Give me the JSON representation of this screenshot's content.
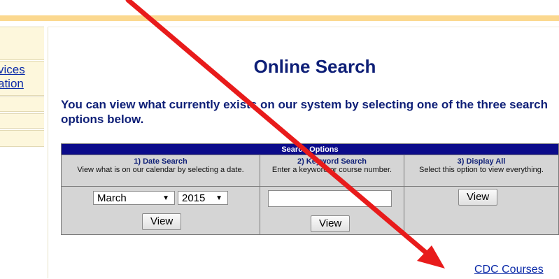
{
  "sidebar": {
    "links": [
      "vices",
      "ation"
    ]
  },
  "main": {
    "title": "Online Search",
    "intro": "You can view what currently exists on our system by selecting one of the three search options below."
  },
  "search_table": {
    "header": "Search Options",
    "options": [
      {
        "title": "1) Date Search",
        "desc": "View what is on our calendar by selecting a date."
      },
      {
        "title": "2) Keyword Search",
        "desc": "Enter a keyword or course number."
      },
      {
        "title": "3) Display All",
        "desc": "Select this option to view everything."
      }
    ],
    "month_value": "March",
    "year_value": "2015",
    "keyword_value": "",
    "view_label": "View"
  },
  "footer": {
    "link": "CDC Courses"
  },
  "colors": {
    "header_bg": "#0b0b8a",
    "title_color": "#0e1f77",
    "link_color": "#0b2aa8",
    "annotation_arrow": "#e81b1b"
  }
}
